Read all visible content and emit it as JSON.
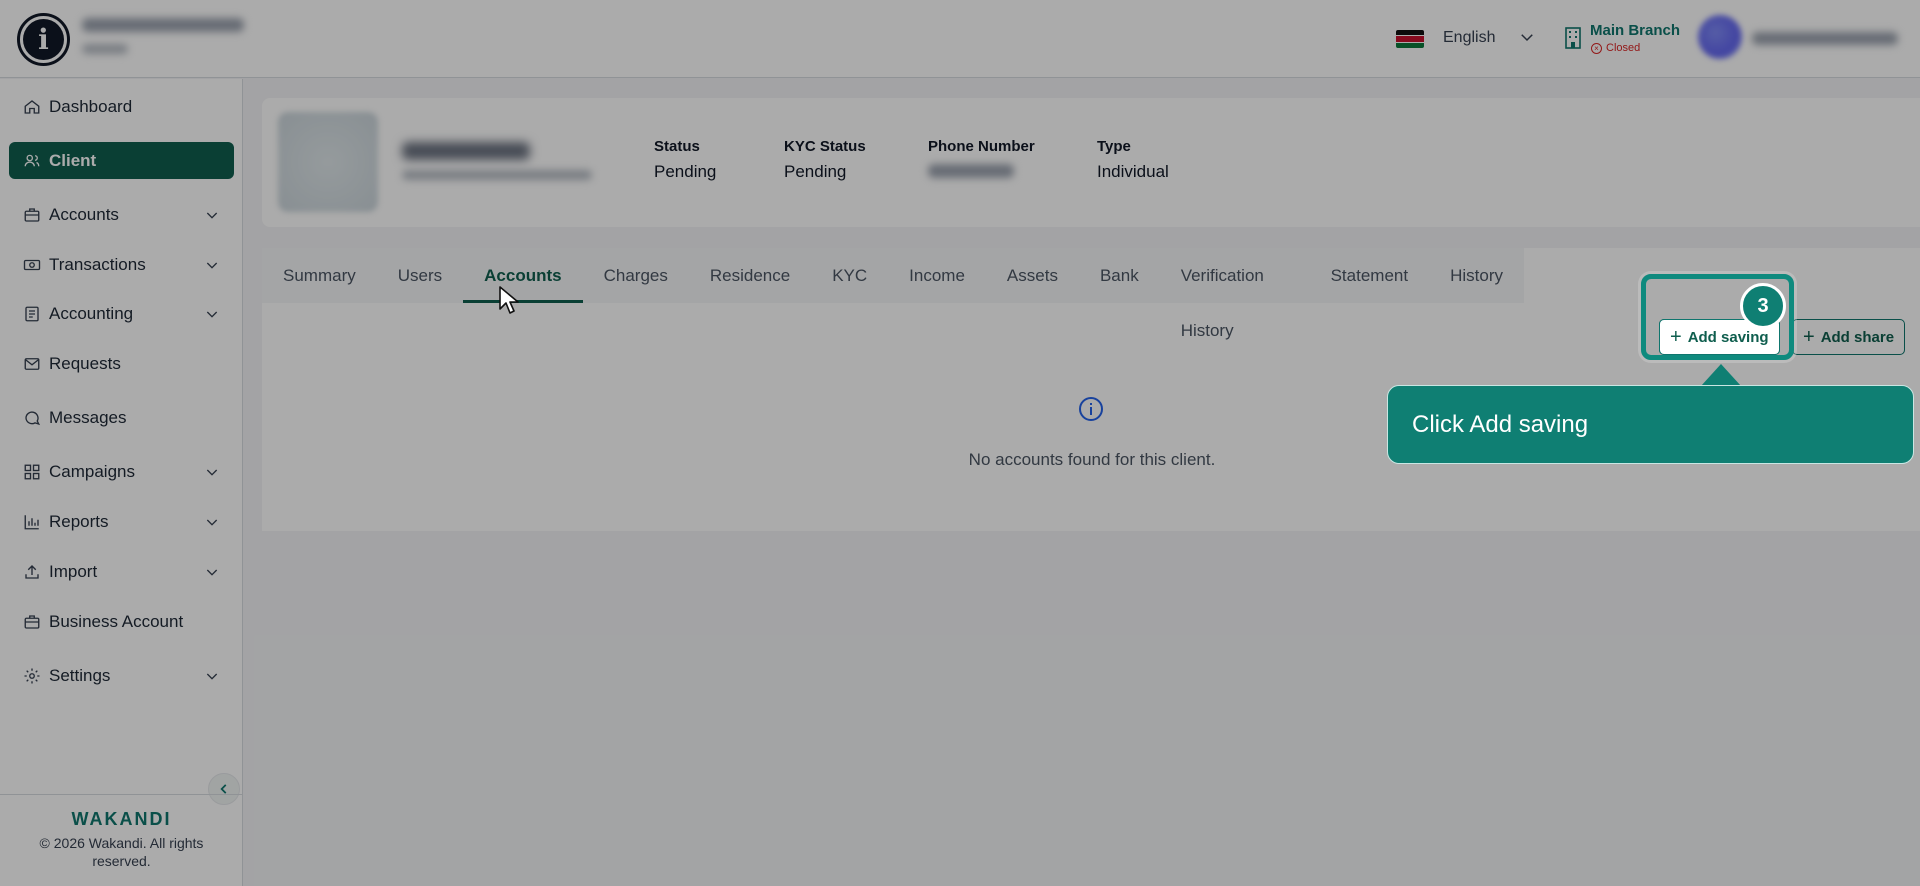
{
  "header": {
    "language": "English",
    "branch": {
      "name": "Main Branch",
      "status": "Closed"
    }
  },
  "sidebar": {
    "items": [
      {
        "label": "Dashboard",
        "icon": "home-icon",
        "has_submenu": false
      },
      {
        "label": "Client",
        "icon": "users-icon",
        "has_submenu": false,
        "active": true
      },
      {
        "label": "Accounts",
        "icon": "briefcase-icon",
        "has_submenu": true
      },
      {
        "label": "Transactions",
        "icon": "cash-icon",
        "has_submenu": true
      },
      {
        "label": "Accounting",
        "icon": "ledger-icon",
        "has_submenu": true
      },
      {
        "label": "Requests",
        "icon": "mail-icon",
        "has_submenu": false
      },
      {
        "label": "Messages",
        "icon": "chat-icon",
        "has_submenu": false
      },
      {
        "label": "Campaigns",
        "icon": "grid-icon",
        "has_submenu": true
      },
      {
        "label": "Reports",
        "icon": "bar-chart-icon",
        "has_submenu": true
      },
      {
        "label": "Import",
        "icon": "upload-icon",
        "has_submenu": true
      },
      {
        "label": "Business Account",
        "icon": "briefcase-icon",
        "has_submenu": false
      },
      {
        "label": "Settings",
        "icon": "gear-icon",
        "has_submenu": true
      }
    ],
    "brand": "WAKANDI",
    "copyright": "© 2026 Wakandi. All rights reserved."
  },
  "profile": {
    "fields": [
      {
        "label": "Status",
        "value": "Pending"
      },
      {
        "label": "KYC Status",
        "value": "Pending"
      },
      {
        "label": "Phone Number",
        "value": ""
      },
      {
        "label": "Type",
        "value": "Individual"
      }
    ]
  },
  "tabs": [
    "Summary",
    "Users",
    "Accounts",
    "Charges",
    "Residence",
    "KYC",
    "Income",
    "Assets",
    "Bank",
    "Verification History",
    "Statement",
    "History"
  ],
  "active_tab": "Accounts",
  "actions": {
    "add_saving": "Add saving",
    "add_share": "Add share"
  },
  "empty_state": "No accounts found for this client.",
  "tour": {
    "step": "3",
    "message": "Click Add saving"
  },
  "colors": {
    "primary": "#0f5e4e",
    "tour": "#0f7f73",
    "danger": "#dc2626"
  }
}
